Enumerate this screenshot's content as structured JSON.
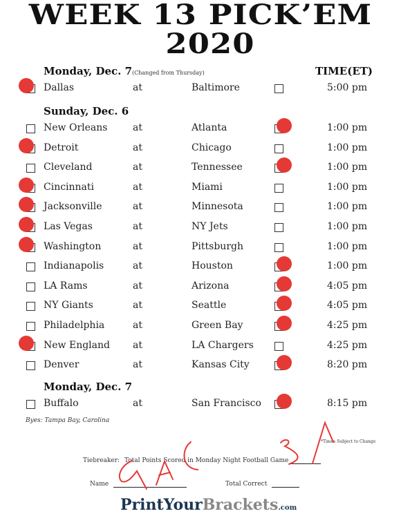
{
  "title": {
    "line1": "WEEK 13 PICK’EM",
    "line2": "2020"
  },
  "time_header": "TIME(ET)",
  "sections": [
    {
      "day": "Monday, Dec. 7",
      "note": "(Changed from Thursday)",
      "games": [
        {
          "away": "Dallas",
          "at": "at",
          "home": "Baltimore",
          "time": "5:00 pm",
          "pick": "away"
        }
      ]
    },
    {
      "day": "Sunday, Dec. 6",
      "note": "",
      "games": [
        {
          "away": "New Orleans",
          "at": "at",
          "home": "Atlanta",
          "time": "1:00 pm",
          "pick": "home"
        },
        {
          "away": "Detroit",
          "at": "at",
          "home": "Chicago",
          "time": "1:00 pm",
          "pick": "away"
        },
        {
          "away": "Cleveland",
          "at": "at",
          "home": "Tennessee",
          "time": "1:00 pm",
          "pick": "home"
        },
        {
          "away": "Cincinnati",
          "at": "at",
          "home": "Miami",
          "time": "1:00 pm",
          "pick": "away"
        },
        {
          "away": "Jacksonville",
          "at": "at",
          "home": "Minnesota",
          "time": "1:00 pm",
          "pick": "away"
        },
        {
          "away": "Las Vegas",
          "at": "at",
          "home": "NY Jets",
          "time": "1:00 pm",
          "pick": "away"
        },
        {
          "away": "Washington",
          "at": "at",
          "home": "Pittsburgh",
          "time": "1:00 pm",
          "pick": "away"
        },
        {
          "away": "Indianapolis",
          "at": "at",
          "home": "Houston",
          "time": "1:00 pm",
          "pick": "home"
        },
        {
          "away": "LA Rams",
          "at": "at",
          "home": "Arizona",
          "time": "4:05 pm",
          "pick": "home"
        },
        {
          "away": "NY Giants",
          "at": "at",
          "home": "Seattle",
          "time": "4:05 pm",
          "pick": "home"
        },
        {
          "away": "Philadelphia",
          "at": "at",
          "home": "Green Bay",
          "time": "4:25 pm",
          "pick": "home"
        },
        {
          "away": "New England",
          "at": "at",
          "home": "LA Chargers",
          "time": "4:25 pm",
          "pick": "away"
        },
        {
          "away": "Denver",
          "at": "at",
          "home": "Kansas City",
          "time": "8:20 pm",
          "pick": "home"
        }
      ]
    },
    {
      "day": "Monday, Dec. 7",
      "note": "",
      "games": [
        {
          "away": "Buffalo",
          "at": "at",
          "home": "San Francisco",
          "time": "8:15 pm",
          "pick": "home"
        }
      ]
    }
  ],
  "byes": "Byes: Tampa Bay, Carolina",
  "times_note": "*Times Subject to Change",
  "tiebreaker": {
    "label": "Tiebreaker:",
    "text": "Total Points Scored in Monday Night Football Game",
    "handwritten_value": "31"
  },
  "name": {
    "label": "Name",
    "handwritten_value": "GAC"
  },
  "total_correct": {
    "label": "Total Correct"
  },
  "logo": {
    "part1": "PrintYour",
    "part2": "Brackets",
    "part3": ".com"
  },
  "colors": {
    "pick_mark": "#e53935",
    "logo_dark": "#1c3553",
    "logo_gray": "#888888"
  }
}
